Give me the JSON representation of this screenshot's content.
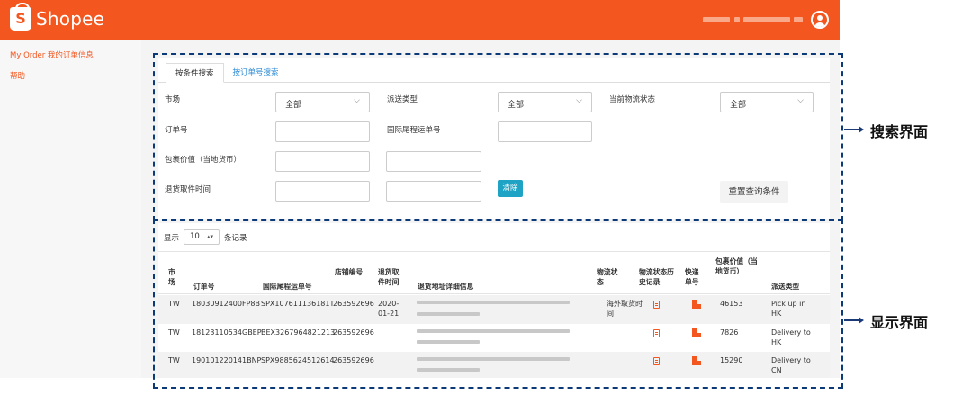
{
  "header": {
    "logo_glyph": "S",
    "logo_text": "Shopee",
    "brand_color": "#f3561f"
  },
  "sidebar": {
    "items": [
      {
        "label": "My Order 我的订单信息"
      },
      {
        "label": "帮助"
      }
    ]
  },
  "search": {
    "tabs": [
      {
        "label": "按条件搜索",
        "active": true
      },
      {
        "label": "按订单号搜索",
        "active": false
      }
    ],
    "fields": {
      "market": {
        "label": "市场",
        "value": "全部"
      },
      "delivery_type": {
        "label": "派送类型",
        "value": "全部"
      },
      "logistics_status": {
        "label": "当前物流状态",
        "value": "全部"
      },
      "order_no": {
        "label": "订单号",
        "value": ""
      },
      "intl_tracking_no": {
        "label": "国际尾程运单号",
        "value": ""
      },
      "parcel_value": {
        "label": "包裹价值（当地货币）"
      },
      "return_pickup_time": {
        "label": "退货取件时间"
      }
    },
    "clear_label": "清除",
    "reset_label": "重置查询条件"
  },
  "list": {
    "show_prefix": "显示",
    "page_size": "10",
    "show_suffix": "条记录",
    "columns": [
      "市场",
      "订单号",
      "国际尾程运单号",
      "店铺编号",
      "退货取件时间",
      "退货地址详细信息",
      "物流状态",
      "物流状态历史记录",
      "快递单号",
      "包裹价值（当地货币）",
      "派送类型"
    ],
    "rows": [
      {
        "market": "TW",
        "order_no": "18030912400FP8B",
        "intl_no": "SPX107611136181T",
        "shop_no": "263592696",
        "pickup_time": "2020-01-21",
        "status": "海外取货时间",
        "value": "46153",
        "delivery": "Pick up in HK"
      },
      {
        "market": "TW",
        "order_no": "18123110534GBEP",
        "intl_no": "BEX3267964821213",
        "shop_no": "263592696",
        "pickup_time": "",
        "status": "",
        "value": "7826",
        "delivery": "Delivery to HK"
      },
      {
        "market": "TW",
        "order_no": "190101220141BNP",
        "intl_no": "SPX9885624512614",
        "shop_no": "263592696",
        "pickup_time": "",
        "status": "",
        "value": "15290",
        "delivery": "Delivery to CN"
      }
    ]
  },
  "annotations": {
    "search_label": "搜索界面",
    "list_label": "显示界面",
    "color": "#0c3a78"
  },
  "icons": {
    "avatar": "user-circle-icon",
    "chevron": "chevron-down-icon",
    "status_history": "document-icon",
    "tracking": "shipment-icon"
  }
}
